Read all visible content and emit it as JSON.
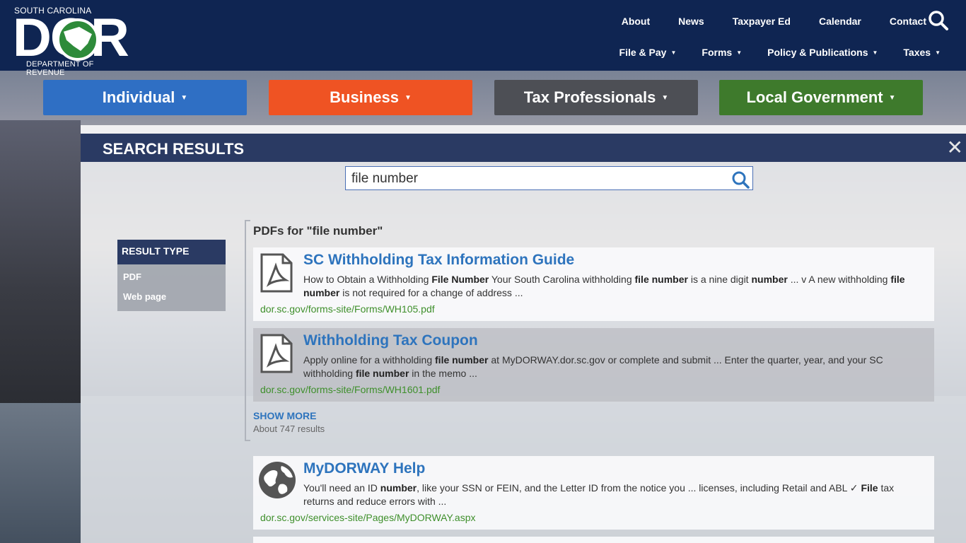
{
  "logo": {
    "top_text": "SOUTH CAROLINA",
    "big_text": "DOR",
    "bottom_text": "DEPARTMENT OF REVENUE"
  },
  "top_nav": [
    "About",
    "News",
    "Taxpayer Ed",
    "Calendar",
    "Contact"
  ],
  "sub_nav": [
    "File & Pay",
    "Forms",
    "Policy & Publications",
    "Taxes"
  ],
  "audience": [
    {
      "label": "Individual",
      "color": "#2f6fc4"
    },
    {
      "label": "Business",
      "color": "#ef5323"
    },
    {
      "label": "Tax Professionals",
      "color": "#4d4f55"
    },
    {
      "label": "Local Government",
      "color": "#3e7a2c"
    }
  ],
  "panel": {
    "title": "SEARCH RESULTS",
    "close": "✕"
  },
  "search": {
    "value": "file number"
  },
  "filter": {
    "heading": "RESULT TYPE",
    "items": [
      "PDF",
      "Web page"
    ]
  },
  "pdf_heading": "PDFs for \"file number\"",
  "results": [
    {
      "title": "SC Withholding Tax Information Guide",
      "snippet_html": "How to Obtain a Withholding <b>File Number</b> Your South Carolina withholding <b>file number</b> is a nine digit <b>number</b> ... v A new withholding <b>file number</b> is not required for a change of address ...",
      "url": "dor.sc.gov/forms-site/Forms/WH105.pdf",
      "icon": "pdf-icon"
    },
    {
      "title": "Withholding Tax Coupon",
      "snippet_html": "Apply online for a withholding <b>file number</b> at MyDORWAY.dor.sc.gov or complete and submit ... Enter the quarter, year, and your SC withholding <b>file number</b> in the memo ...",
      "url": "dor.sc.gov/forms-site/Forms/WH1601.pdf",
      "icon": "pdf-icon"
    },
    {
      "title": "MyDORWAY Help",
      "snippet_html": "You'll need an ID <b>number</b>, like your SSN or FEIN, and the Letter ID from the notice you ... licenses, including Retail and ABL ✓ <b>File</b> tax returns and reduce errors with ...",
      "url": "dor.sc.gov/services-site/Pages/MyDORWAY.aspx",
      "icon": "globe-icon"
    }
  ],
  "show_more": "SHOW MORE",
  "count": "About 747 results"
}
